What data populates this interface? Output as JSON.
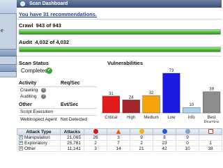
{
  "window": {
    "title": "Scan Dashboard"
  },
  "sidebar": {
    "text": "e"
  },
  "recommendations": {
    "text": "You have 31 recommendations."
  },
  "crawl": {
    "label": "Crawl",
    "value": "943 of 943",
    "progress": 1.0
  },
  "audit": {
    "label": "Audit",
    "value": "4,032 of 4,032",
    "progress": 1.0
  },
  "scan_status": {
    "heading": "Scan Status",
    "state": "Completed",
    "state_icon": "check-circle-icon",
    "activity_header": "Activity",
    "req_sec_header": "Req/Sec",
    "activities": [
      "Crawling",
      "Auditing"
    ],
    "other_header": "Other",
    "evt_sec_header": "Evt/Sec",
    "other_items": [
      "Script Execution"
    ],
    "agent_label": "WebInspect Agent",
    "agent_value": "Not Detected"
  },
  "colors": {
    "critical": "#e11b1b",
    "high": "#a3242a",
    "medium": "#f5a30d",
    "low": "#1a1ae0",
    "info": "#a9d4ea",
    "best_practice": "#8c8c8c",
    "progress": "#47b42a"
  },
  "chart_data": {
    "type": "bar",
    "title": "Vulnerabilities",
    "categories": [
      "Critical",
      "High",
      "Medium",
      "Low",
      "Info",
      "Best Practice"
    ],
    "values": [
      31,
      24,
      32,
      73,
      10,
      39
    ],
    "colors": [
      "#e11b1b",
      "#a3242a",
      "#f5a30d",
      "#1a1ae0",
      "#a9d4ea",
      "#8c8c8c"
    ],
    "ylim": [
      0,
      73
    ],
    "grid": false,
    "legend": "none"
  },
  "attack_table": {
    "headers": [
      "Attack Type",
      "Attacks"
    ],
    "severity_columns": [
      "critical-icon",
      "warning-icon",
      "alert-icon",
      "info-icon",
      "question-icon",
      "check-icon"
    ],
    "rows": [
      {
        "name": "Manipulation",
        "attacks": "21,065",
        "c1": "26",
        "c2": "3",
        "c3": "9",
        "c4": "8",
        "c5": "9",
        "c6": ""
      },
      {
        "name": "Exploratory",
        "attacks": "25,781",
        "c1": "2",
        "c2": "7",
        "c3": "2",
        "c4": "23",
        "c5": "0",
        "c6": "1"
      },
      {
        "name": "Other",
        "attacks": "11,141",
        "c1": "3",
        "c2": "14",
        "c3": "21",
        "c4": "42",
        "c5": "10",
        "c6": "38"
      }
    ]
  }
}
